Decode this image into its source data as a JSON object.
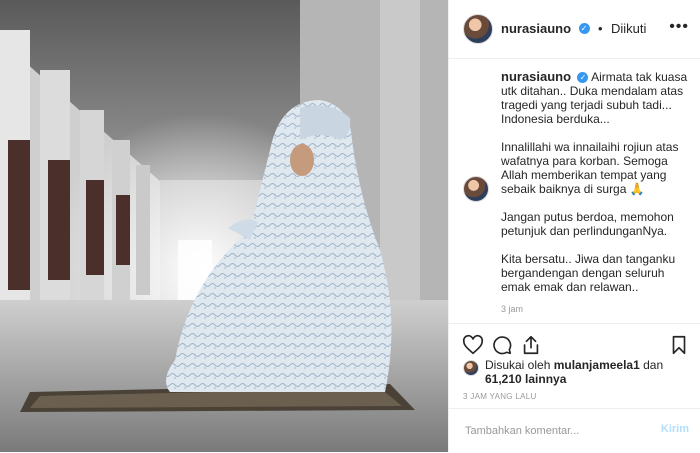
{
  "post": {
    "username": "nurasiauno",
    "follow_status": "Diikuti",
    "dot": "•",
    "caption_lines": [
      "Airmata tak kuasa utk ditahan.. Duka mendalam atas tragedi yang terjadi subuh tadi... Indonesia berduka...",
      "Innalillahi wa innailaihi rojiun atas wafatnya para korban. Semoga Allah memberikan tempat yang sebaik baiknya di surga 🙏",
      "Jangan putus berdoa, memohon petunjuk dan perlindunganNya.",
      "Kita bersatu.. Jiwa dan tanganku bergandengan dengan seluruh emak emak dan relawan.."
    ],
    "caption_time": "3 jam",
    "likes_prefix": "Disukai oleh",
    "likes_user": "mulanjameela1",
    "likes_and": "dan",
    "likes_count": "61,210 lainnya",
    "post_time": "3 JAM YANG LALU",
    "comment_placeholder": "Tambahkan komentar...",
    "send_label": "Kirim"
  },
  "icons": {
    "verified": "verified-badge-icon",
    "more": "more-options-icon",
    "like": "heart-icon",
    "comment": "comment-icon",
    "share": "share-icon",
    "save": "bookmark-icon"
  },
  "colors": {
    "accent": "#3897f0",
    "send_disabled": "#b2dffc",
    "border": "#efefef"
  }
}
